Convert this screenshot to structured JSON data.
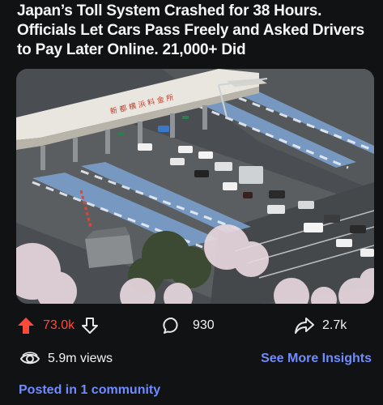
{
  "post": {
    "title": "Japan’s Toll System Crashed for 38 Hours. Officials Let Cars Pass Freely and Asked Drivers to Pay Later Online. 21,000+ Did"
  },
  "image": {
    "alt_icon": "aerial-photo",
    "sign_text": "新 都 横 浜 料 金 所"
  },
  "actions": {
    "upvotes": "73.0k",
    "comments": "930",
    "shares": "2.7k"
  },
  "stats": {
    "views": "5.9m views",
    "insights_label": "See More Insights"
  },
  "footer": {
    "community_label": "Posted in 1 community"
  },
  "colors": {
    "background": "#111214",
    "upvote": "#ff4a3a",
    "link": "#6f8cff"
  }
}
